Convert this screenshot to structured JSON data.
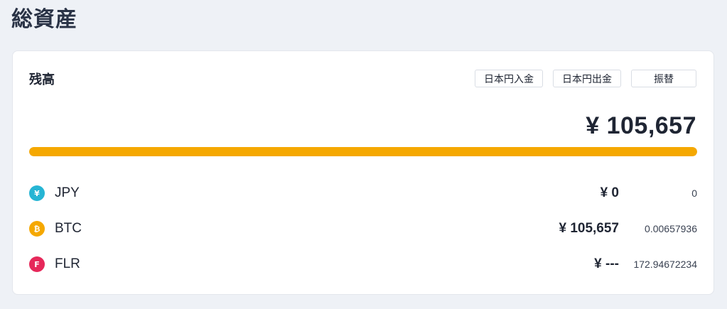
{
  "page": {
    "title": "総資産"
  },
  "balance": {
    "title": "残高",
    "buttons": {
      "deposit": "日本円入金",
      "withdraw": "日本円出金",
      "transfer": "振替"
    },
    "total": "¥ 105,657",
    "bar_fill_percent": 100,
    "bar_color": "#f5a800",
    "assets": [
      {
        "symbol": "JPY",
        "icon": "yen-icon",
        "glyph": "¥",
        "color": "#26b5d4",
        "value_jpy": "¥ 0",
        "amount": "0"
      },
      {
        "symbol": "BTC",
        "icon": "bitcoin-icon",
        "glyph": "₿",
        "color": "#f5a800",
        "value_jpy": "¥ 105,657",
        "amount": "0.00657936"
      },
      {
        "symbol": "FLR",
        "icon": "flare-icon",
        "glyph": "F",
        "color": "#e6285a",
        "value_jpy": "¥ ---",
        "amount": "172.94672234"
      }
    ]
  }
}
